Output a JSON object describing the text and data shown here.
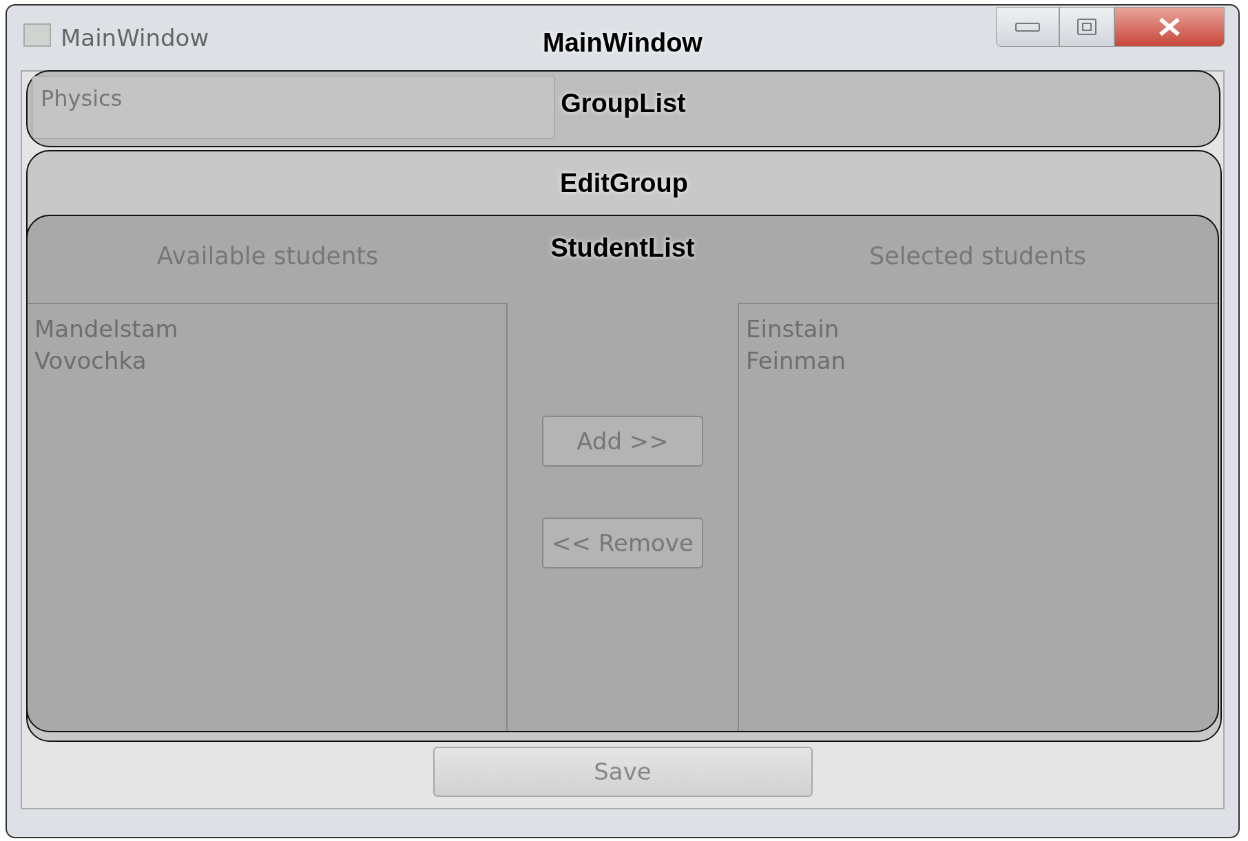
{
  "window": {
    "title": "MainWindow",
    "overlay_label": "MainWindow"
  },
  "group_list": {
    "overlay_label": "GroupList",
    "selected_group": "Physics"
  },
  "edit_group": {
    "overlay_label": "EditGroup",
    "student_list": {
      "overlay_label": "StudentList",
      "available": {
        "header": "Available students",
        "items": [
          "Mandelstam",
          "Vovochka"
        ]
      },
      "selected": {
        "header": "Selected students",
        "items": [
          "Einstain",
          "Feinman"
        ]
      },
      "buttons": [
        "Add >>",
        "<< Remove"
      ]
    }
  },
  "save_button": "Save"
}
